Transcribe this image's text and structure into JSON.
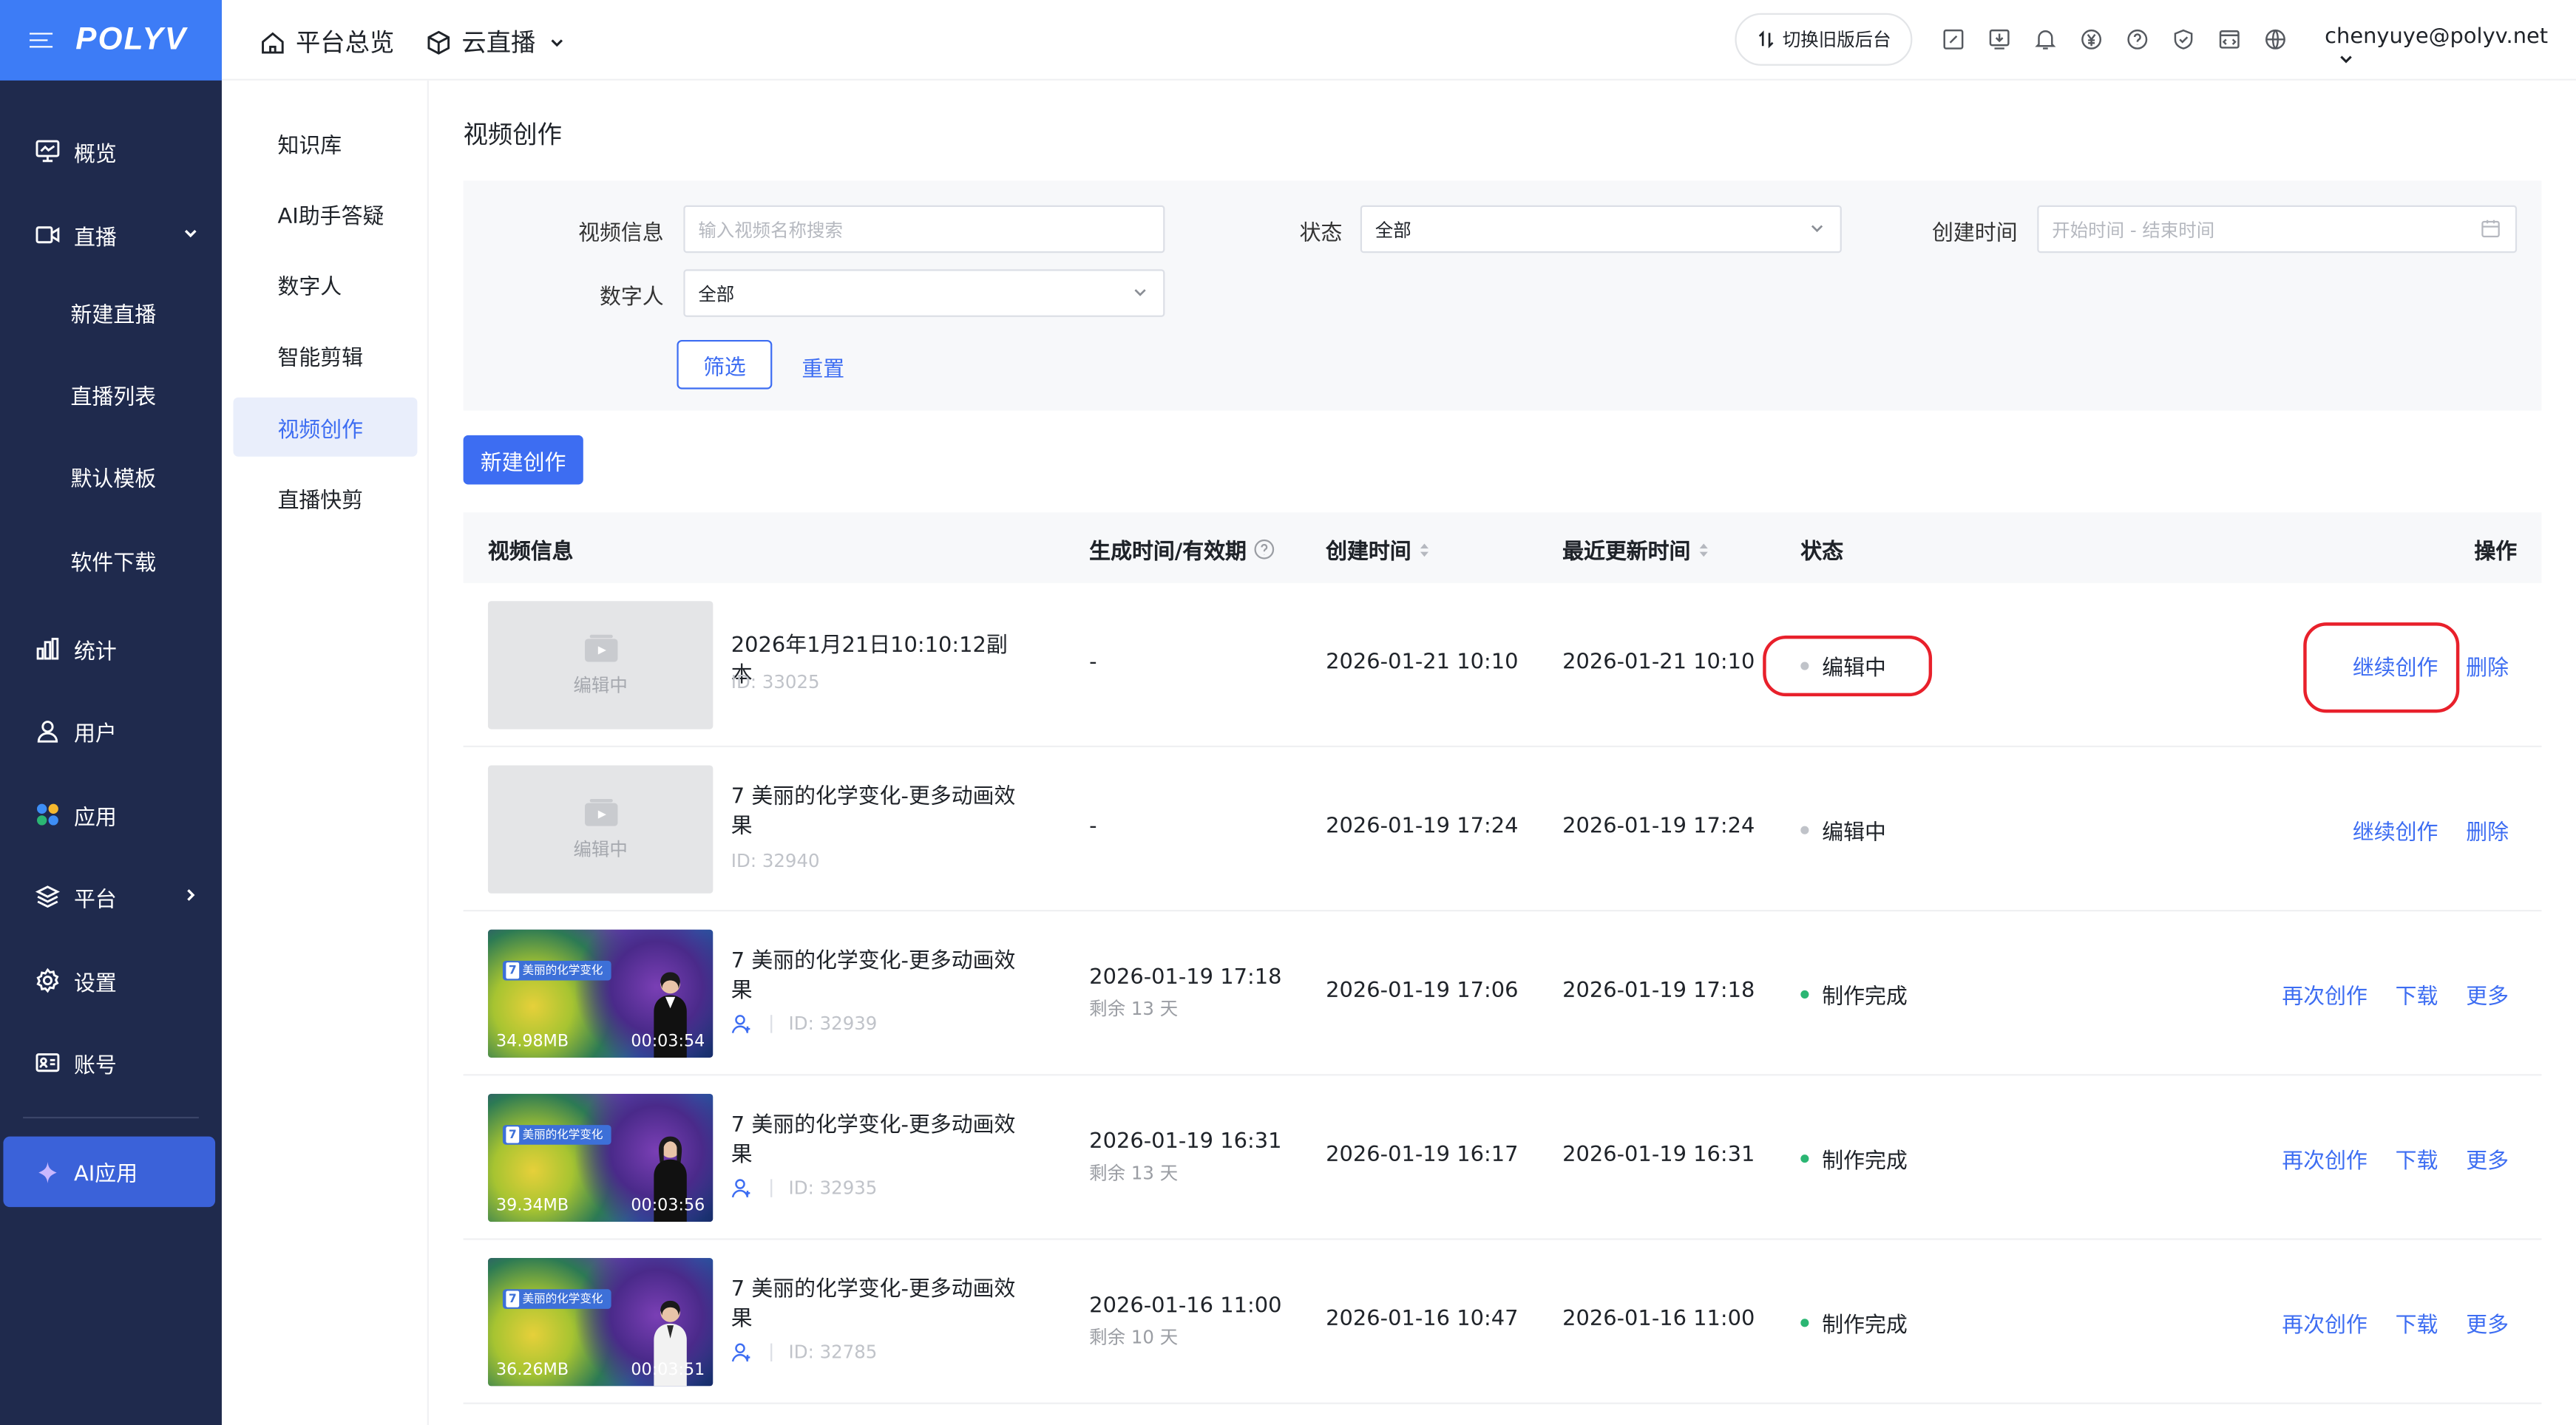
{
  "app": {
    "logo": "POLYV"
  },
  "sidebar": {
    "items": [
      {
        "label": "概览",
        "icon": "monitor-icon"
      },
      {
        "label": "直播",
        "icon": "video-icon"
      },
      {
        "label": "新建直播"
      },
      {
        "label": "直播列表"
      },
      {
        "label": "默认模板"
      },
      {
        "label": "软件下载"
      },
      {
        "label": "统计",
        "icon": "chart-icon"
      },
      {
        "label": "用户",
        "icon": "user-icon"
      },
      {
        "label": "应用",
        "icon": "apps-icon"
      },
      {
        "label": "平台",
        "icon": "layers-icon"
      },
      {
        "label": "设置",
        "icon": "gear-icon"
      },
      {
        "label": "账号",
        "icon": "id-card-icon"
      }
    ],
    "ai_label": "AI应用"
  },
  "submenu": {
    "items": [
      "知识库",
      "AI助手答疑",
      "数字人",
      "智能剪辑",
      "视频创作",
      "直播快剪"
    ],
    "active": "视频创作"
  },
  "topbar": {
    "home_label": "平台总览",
    "cloud_label": "云直播",
    "switch_label": "切换旧版后台",
    "email": "chenyuye@polyv.net"
  },
  "page": {
    "title": "视频创作"
  },
  "filter": {
    "video_info_label": "视频信息",
    "video_info_placeholder": "输入视频名称搜索",
    "status_label": "状态",
    "status_value": "全部",
    "created_label": "创建时间",
    "created_placeholder": "开始时间 - 结束时间",
    "digital_human_label": "数字人",
    "digital_human_value": "全部",
    "filter_btn": "筛选",
    "reset_btn": "重置"
  },
  "new_btn": "新建创作",
  "table": {
    "headers": {
      "info": "视频信息",
      "gen_time": "生成时间/有效期",
      "created": "创建时间",
      "updated": "最近更新时间",
      "status": "状态",
      "ops": "操作"
    },
    "rows": [
      {
        "title": "2026年1月21日10:10:12副本",
        "id": "ID: 33025",
        "thumb_text": "编辑中",
        "gen_time": "-",
        "created": "2026-01-21 10:10",
        "updated": "2026-01-21 10:10",
        "status": "编辑中",
        "ops": [
          "继续创作",
          "删除"
        ]
      },
      {
        "title": "7 美丽的化学变化-更多动画效果",
        "id": "ID: 32940",
        "thumb_text": "编辑中",
        "gen_time": "-",
        "created": "2026-01-19 17:24",
        "updated": "2026-01-19 17:24",
        "status": "编辑中",
        "ops": [
          "继续创作",
          "删除"
        ]
      },
      {
        "title": "7 美丽的化学变化-更多动画效果",
        "id": "ID: 32939",
        "size": "34.98MB",
        "duration": "00:03:54",
        "thumb_tag": "美丽的化学变化",
        "thumb_tag_num": "7",
        "gen_time": "2026-01-19 17:18",
        "remain": "剩余 13 天",
        "created": "2026-01-19 17:06",
        "updated": "2026-01-19 17:18",
        "status": "制作完成",
        "ops": [
          "再次创作",
          "下载",
          "更多"
        ]
      },
      {
        "title": "7 美丽的化学变化-更多动画效果",
        "id": "ID: 32935",
        "size": "39.34MB",
        "duration": "00:03:56",
        "thumb_tag": "美丽的化学变化",
        "thumb_tag_num": "7",
        "gen_time": "2026-01-19 16:31",
        "remain": "剩余 13 天",
        "created": "2026-01-19 16:17",
        "updated": "2026-01-19 16:31",
        "status": "制作完成",
        "ops": [
          "再次创作",
          "下载",
          "更多"
        ]
      },
      {
        "title": "7 美丽的化学变化-更多动画效果",
        "id": "ID: 32785",
        "size": "36.26MB",
        "duration": "00:03:51",
        "thumb_tag": "美丽的化学变化",
        "thumb_tag_num": "7",
        "gen_time": "2026-01-16 11:00",
        "remain": "剩余 10 天",
        "created": "2026-01-16 10:47",
        "updated": "2026-01-16 11:00",
        "status": "制作完成",
        "ops": [
          "再次创作",
          "下载",
          "更多"
        ]
      }
    ]
  },
  "colors": {
    "accent": "#3d6df2",
    "sidebar": "#1f2a4d",
    "logo_bar": "#3d7cf6",
    "status_editing": "#c0c3c9",
    "status_done": "#2bb673",
    "highlight": "#e8202b"
  }
}
